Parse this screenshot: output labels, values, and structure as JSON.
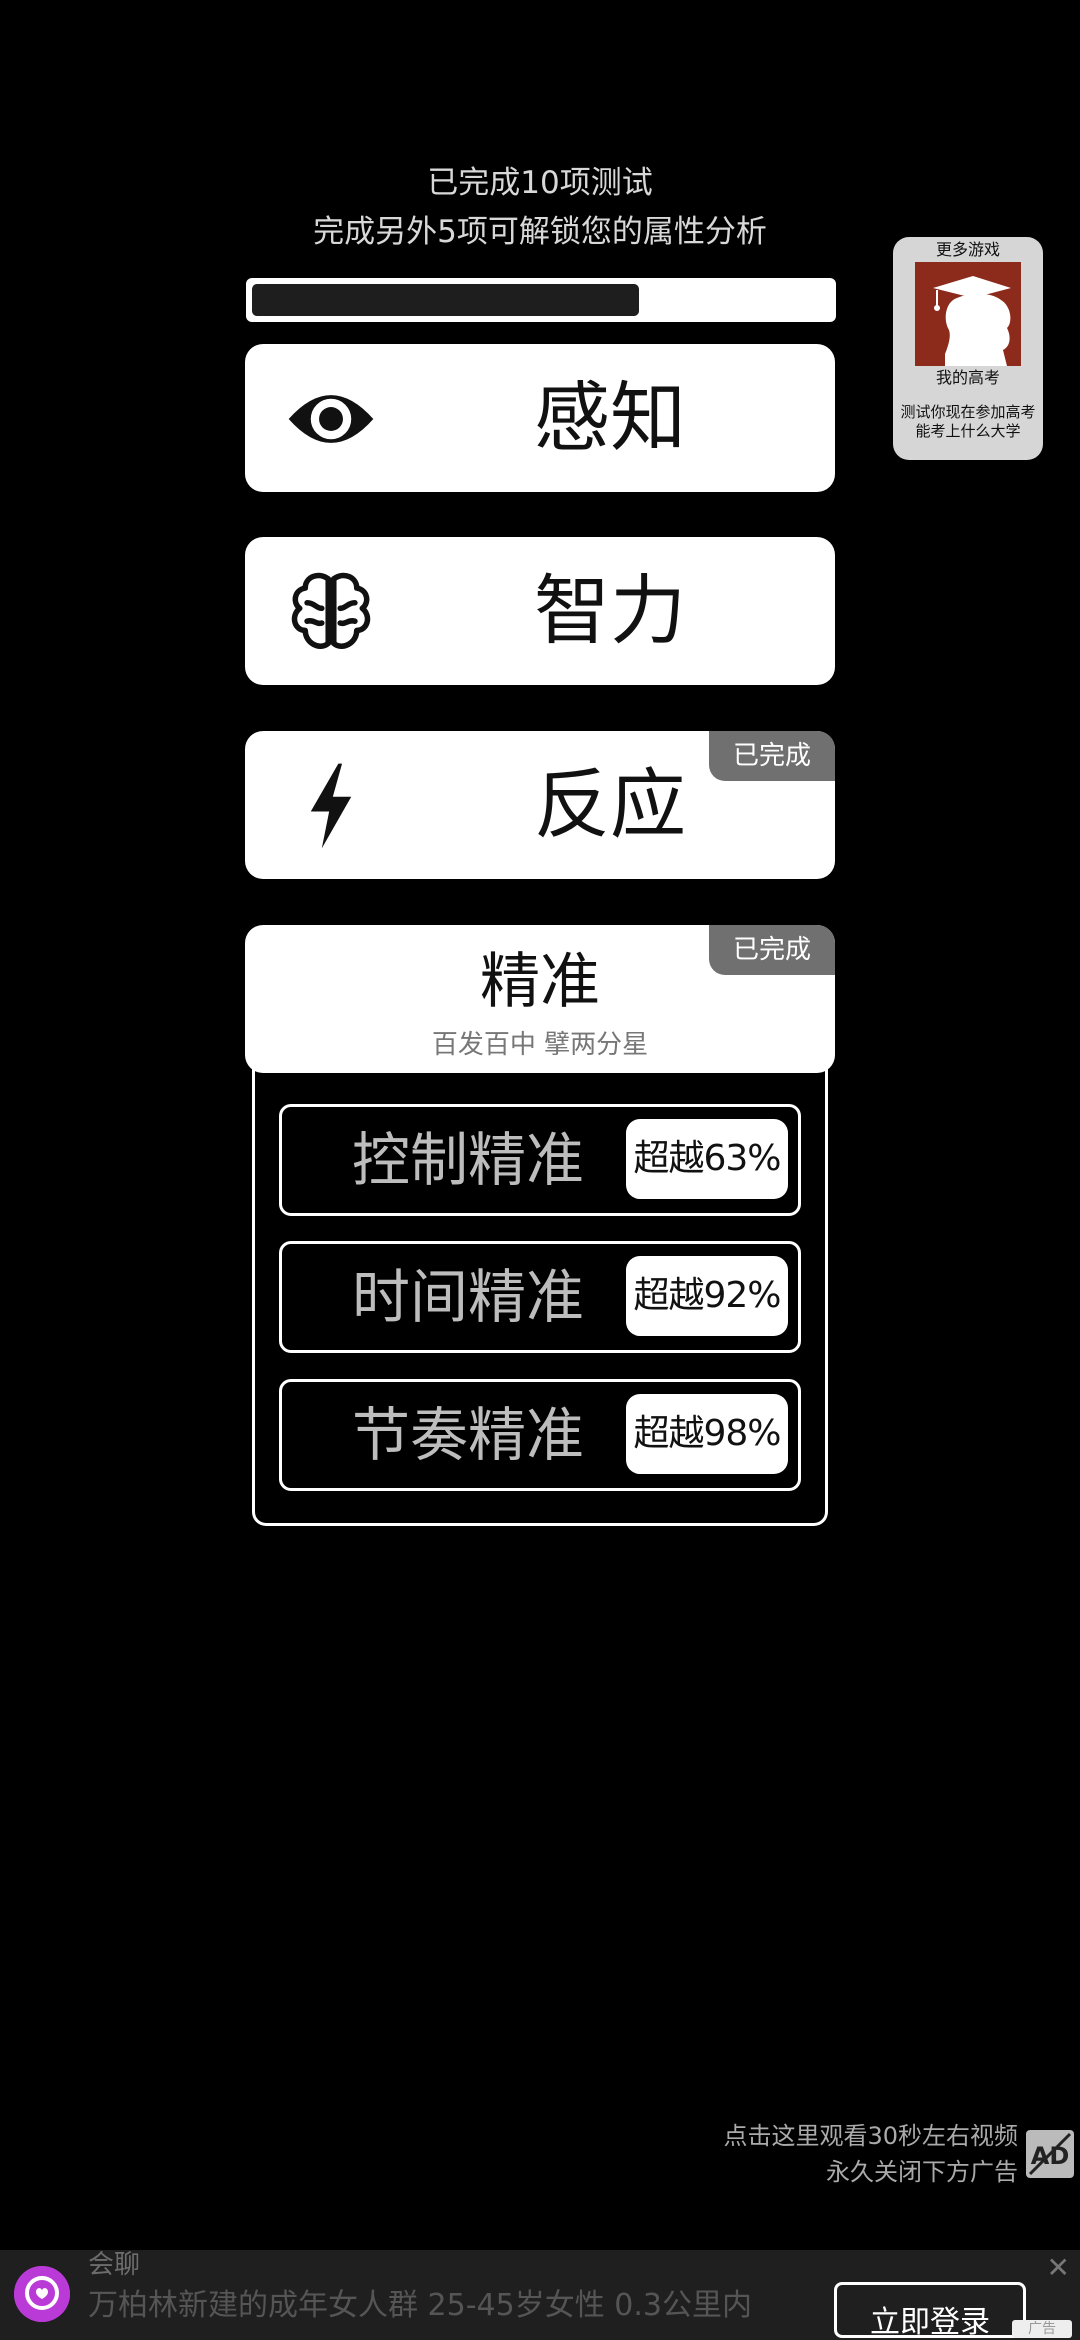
{
  "header": {
    "line1": "已完成10项测试",
    "line2": "完成另外5项可解锁您的属性分析"
  },
  "progress": {
    "completed": 10,
    "total": 15,
    "fraction": 0.67
  },
  "cards": [
    {
      "title": "感知",
      "icon": "eye-icon",
      "done": false
    },
    {
      "title": "智力",
      "icon": "brain-icon",
      "done": false
    },
    {
      "title": "反应",
      "icon": "lightning-icon",
      "done": true,
      "badge": "已完成"
    }
  ],
  "expanded_card": {
    "title": "精准",
    "subtitle": "百发百中 擘两分星",
    "badge": "已完成",
    "items": [
      {
        "label": "控制精准",
        "result": "超越63%"
      },
      {
        "label": "时间精准",
        "result": "超越92%"
      },
      {
        "label": "节奏精准",
        "result": "超越98%"
      }
    ]
  },
  "more_games": {
    "title": "更多游戏",
    "game_name": "我的高考",
    "game_desc": "测试你现在参加高考能考上什么大学",
    "thumb_color": "#8c2b1c"
  },
  "ad_hint": {
    "line1": "点击这里观看30秒左右视频",
    "line2": "永久关闭下方广告"
  },
  "banner": {
    "app_name": "会聊",
    "text": "万柏林新建的成年女人群 25-45岁女性 0.3公里内",
    "button": "立即登录",
    "close": "✕",
    "ad_label": "广告",
    "logo_color": "#b93ad6"
  }
}
